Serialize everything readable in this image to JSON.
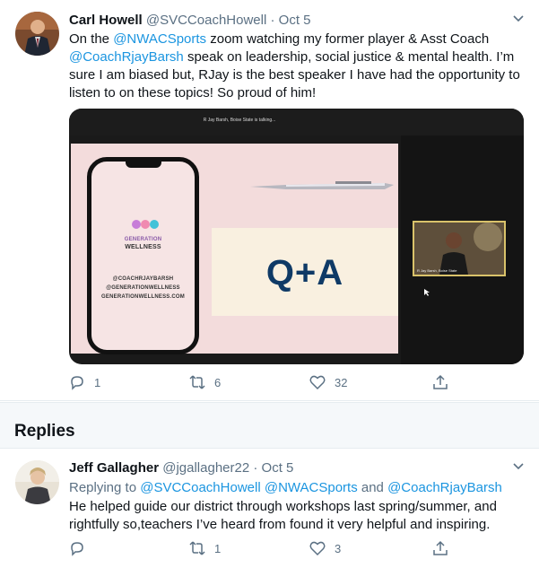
{
  "tweet": {
    "author_name": "Carl Howell",
    "handle": "@SVCCoachHowell",
    "separator": "·",
    "date": "Oct 5",
    "text_part1": "On the ",
    "mention1": "@NWACSports",
    "text_part2": " zoom watching my former player & Asst Coach ",
    "mention2": "@CoachRjayBarsh",
    "text_part3": " speak on leadership, social justice & mental health. I’m sure I am biased but, RJay is the best speaker  I have had the opportunity to listen to on these topics! So proud of him!",
    "media": {
      "talking_text": "R Jay Barsh, Boise State is talking...",
      "logo_text_1": "GENERATION",
      "logo_text_2": "WELLNESS",
      "contact_1": "@COACHRJAYBARSH",
      "contact_2": "@GENERATIONWELLNESS",
      "contact_3": "GENERATIONWELLNESS.COM",
      "qa_text": "Q+A",
      "cam_label": "R Jay Barsh, Boise State"
    },
    "reply_count": "1",
    "retweet_count": "6",
    "like_count": "32"
  },
  "replies_header": "Replies",
  "reply": {
    "author_name": "Jeff Gallagher",
    "handle": "@jgallagher22",
    "separator": "·",
    "date": "Oct 5",
    "replying_prefix": "Replying to ",
    "replying_to_1": "@SVCCoachHowell",
    "replying_to_2": "@NWACSports",
    "and_text": " and ",
    "replying_to_3": "@CoachRjayBarsh",
    "text": "He helped guide our district through workshops last spring/summer, and rightfully so,teachers I’ve heard from found it very helpful and inspiring.",
    "reply_count": "",
    "retweet_count": "1",
    "like_count": "3"
  },
  "colors": {
    "link": "#1b95e0",
    "secondary": "#5b7083",
    "text": "#0f1419"
  },
  "icons": [
    "chevron-down-icon",
    "reply-icon",
    "retweet-icon",
    "like-icon",
    "share-icon"
  ]
}
